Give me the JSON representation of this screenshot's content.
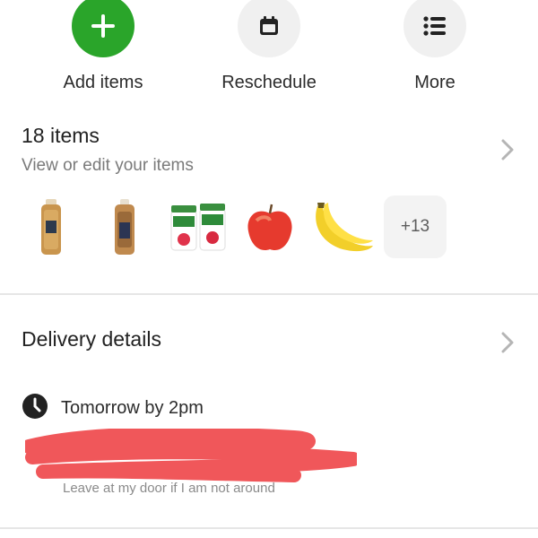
{
  "actions": [
    {
      "label": "Add items",
      "icon": "plus-icon"
    },
    {
      "label": "Reschedule",
      "icon": "calendar-icon"
    },
    {
      "label": "More",
      "icon": "list-icon"
    }
  ],
  "items": {
    "count_label": "18 items",
    "subtitle": "View or edit your items",
    "thumbnails": [
      "bread-loaf-product",
      "bread-loaf-product",
      "activia-yogurt-product",
      "apple-product",
      "banana-product"
    ],
    "overflow_label": "+13"
  },
  "delivery": {
    "title": "Delivery details",
    "slot": "Tomorrow by 2pm",
    "instructions": "Leave at my door if I am not around"
  },
  "colors": {
    "accent_green": "#2aa52a",
    "icon_bg": "#f0f0f0",
    "redaction": "#f0575a"
  }
}
